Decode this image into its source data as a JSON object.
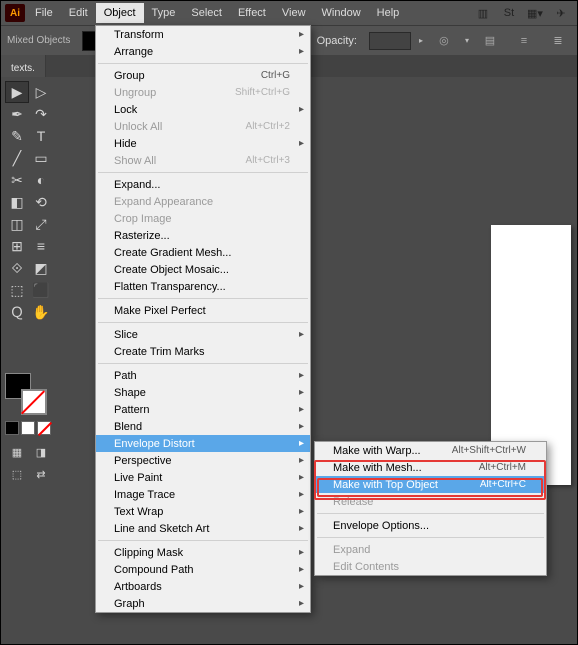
{
  "app_icon": "Ai",
  "menubar": [
    "File",
    "Edit",
    "Object",
    "Type",
    "Select",
    "Effect",
    "View",
    "Window",
    "Help"
  ],
  "open_menu_index": 2,
  "control": {
    "mixed": "Mixed Objects",
    "opacity_label": "Opacity:"
  },
  "doc_tab": "texts.",
  "object_menu": [
    {
      "label": "Transform",
      "sub": true
    },
    {
      "label": "Arrange",
      "sub": true
    },
    {
      "sep": true
    },
    {
      "label": "Group",
      "shortcut": "Ctrl+G"
    },
    {
      "label": "Ungroup",
      "shortcut": "Shift+Ctrl+G",
      "disabled": true
    },
    {
      "label": "Lock",
      "sub": true
    },
    {
      "label": "Unlock All",
      "shortcut": "Alt+Ctrl+2",
      "disabled": true
    },
    {
      "label": "Hide",
      "sub": true
    },
    {
      "label": "Show All",
      "shortcut": "Alt+Ctrl+3",
      "disabled": true
    },
    {
      "sep": true
    },
    {
      "label": "Expand..."
    },
    {
      "label": "Expand Appearance",
      "disabled": true
    },
    {
      "label": "Crop Image",
      "disabled": true
    },
    {
      "label": "Rasterize..."
    },
    {
      "label": "Create Gradient Mesh..."
    },
    {
      "label": "Create Object Mosaic..."
    },
    {
      "label": "Flatten Transparency..."
    },
    {
      "sep": true
    },
    {
      "label": "Make Pixel Perfect"
    },
    {
      "sep": true
    },
    {
      "label": "Slice",
      "sub": true
    },
    {
      "label": "Create Trim Marks"
    },
    {
      "sep": true
    },
    {
      "label": "Path",
      "sub": true
    },
    {
      "label": "Shape",
      "sub": true
    },
    {
      "label": "Pattern",
      "sub": true
    },
    {
      "label": "Blend",
      "sub": true
    },
    {
      "label": "Envelope Distort",
      "sub": true,
      "highlight": true
    },
    {
      "label": "Perspective",
      "sub": true
    },
    {
      "label": "Live Paint",
      "sub": true
    },
    {
      "label": "Image Trace",
      "sub": true
    },
    {
      "label": "Text Wrap",
      "sub": true
    },
    {
      "label": "Line and Sketch Art",
      "sub": true
    },
    {
      "sep": true
    },
    {
      "label": "Clipping Mask",
      "sub": true
    },
    {
      "label": "Compound Path",
      "sub": true
    },
    {
      "label": "Artboards",
      "sub": true
    },
    {
      "label": "Graph",
      "sub": true
    }
  ],
  "submenu": [
    {
      "label": "Make with Warp...",
      "shortcut": "Alt+Shift+Ctrl+W"
    },
    {
      "label": "Make with Mesh...",
      "shortcut": "Alt+Ctrl+M"
    },
    {
      "label": "Make with Top Object",
      "shortcut": "Alt+Ctrl+C",
      "highlight": true
    },
    {
      "label": "Release",
      "disabled": true
    },
    {
      "sep": true
    },
    {
      "label": "Envelope Options..."
    },
    {
      "sep": true
    },
    {
      "label": "Expand",
      "disabled": true
    },
    {
      "label": "Edit Contents",
      "disabled": true
    }
  ],
  "tools": [
    "▶",
    "▷",
    "✒",
    "↷",
    "✎",
    "T",
    "╱",
    "▭",
    "✂",
    "◐",
    "◧",
    "⟲",
    "◫",
    "⤢",
    "⊞",
    "≡",
    "⟐",
    "◩",
    "⬚",
    "⬛",
    "Ｑ",
    "✋"
  ],
  "tools_bottom": [
    "▦",
    "◨",
    "⬚",
    "⇄"
  ]
}
